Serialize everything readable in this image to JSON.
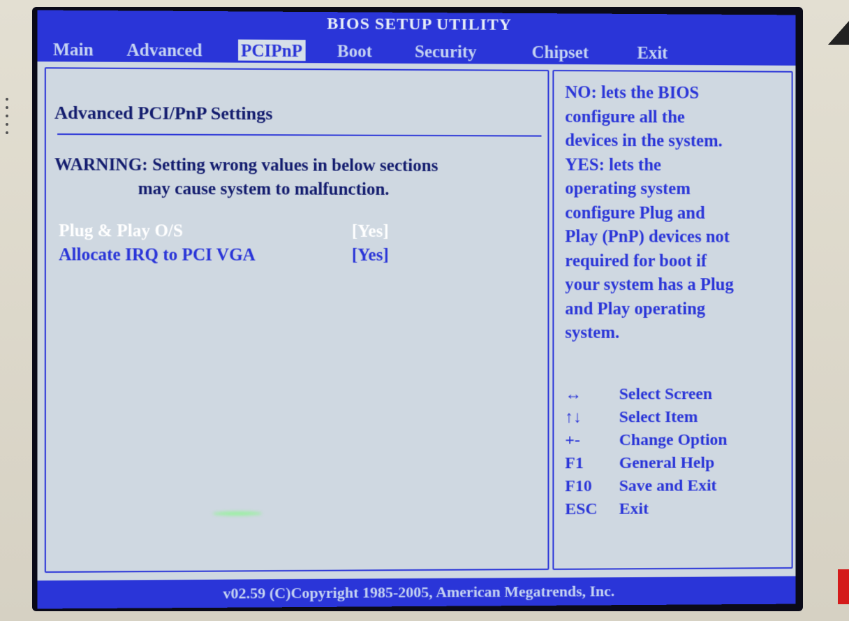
{
  "window": {
    "title": "BIOS SETUP UTILITY"
  },
  "tabs": [
    {
      "label": "Main",
      "active": false
    },
    {
      "label": "Advanced",
      "active": false
    },
    {
      "label": "PCIPnP",
      "active": true
    },
    {
      "label": "Boot",
      "active": false
    },
    {
      "label": "Security",
      "active": false
    },
    {
      "label": "Chipset",
      "active": false
    },
    {
      "label": "Exit",
      "active": false
    }
  ],
  "main": {
    "section_title": "Advanced PCI/PnP Settings",
    "warning_line1": "WARNING: Setting wrong values in below sections",
    "warning_line2": "may cause system to malfunction.",
    "settings": [
      {
        "label": "Plug & Play O/S",
        "value": "[Yes]",
        "selected": true
      },
      {
        "label": "Allocate IRQ to PCI VGA",
        "value": "[Yes]",
        "selected": false
      }
    ]
  },
  "help": {
    "lines": [
      "NO: lets the BIOS",
      "configure all the",
      "devices in the system.",
      "YES: lets the",
      "operating system",
      "configure Plug and",
      "Play (PnP) devices not",
      "required for boot if",
      "your system has a Plug",
      "and Play operating",
      "system."
    ],
    "keys": [
      {
        "key": "↔",
        "desc": "Select Screen"
      },
      {
        "key": "↑↓",
        "desc": "Select Item"
      },
      {
        "key": "+-",
        "desc": "Change Option"
      },
      {
        "key": "F1",
        "desc": "General Help"
      },
      {
        "key": "F10",
        "desc": "Save and Exit"
      },
      {
        "key": "ESC",
        "desc": "Exit"
      }
    ]
  },
  "footer": {
    "copyright": "v02.59 (C)Copyright 1985-2005, American Megatrends, Inc."
  },
  "colors": {
    "bios_blue": "#2a35d8",
    "panel_bg": "#cfd8e1",
    "highlight_white": "#ffffff"
  }
}
